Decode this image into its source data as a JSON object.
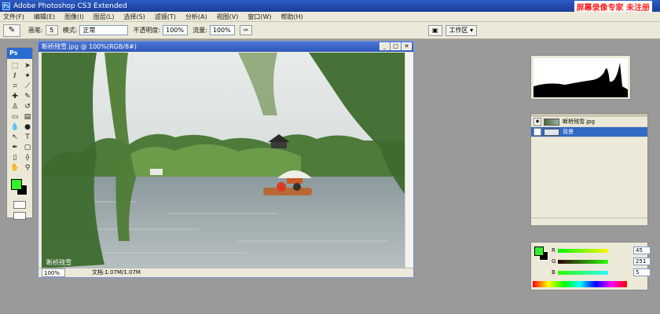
{
  "titlebar": {
    "title": "Adobe Photoshop CS3 Extended",
    "watermark": "屏幕录像专家 未注册"
  },
  "menu": [
    "文件(F)",
    "编辑(E)",
    "图像(I)",
    "图层(L)",
    "选择(S)",
    "滤镜(T)",
    "分析(A)",
    "视图(V)",
    "窗口(W)",
    "帮助(H)"
  ],
  "options": {
    "brush_label": "画笔:",
    "brush_size": "5",
    "mode_label": "模式:",
    "mode_value": "正常",
    "opacity_label": "不透明度:",
    "opacity_value": "100%",
    "flow_label": "流量:",
    "flow_value": "100%",
    "workspace_label": "工作区 ▾"
  },
  "toolbox": {
    "brand": "Ps"
  },
  "document": {
    "title": "断桥残雪.jpg @ 100%(RGB/8#)",
    "zoom": "100%",
    "doc_info": "文档:1.07M/1.07M"
  },
  "layers": {
    "layer1_name": "断桥残雪.jpg",
    "layer2_name": "背景"
  },
  "color": {
    "r_label": "R",
    "g_label": "G",
    "b_label": "B",
    "r_value": "45",
    "g_value": "251",
    "b_value": "5",
    "fg": "#35f02a",
    "bg": "#000000"
  }
}
